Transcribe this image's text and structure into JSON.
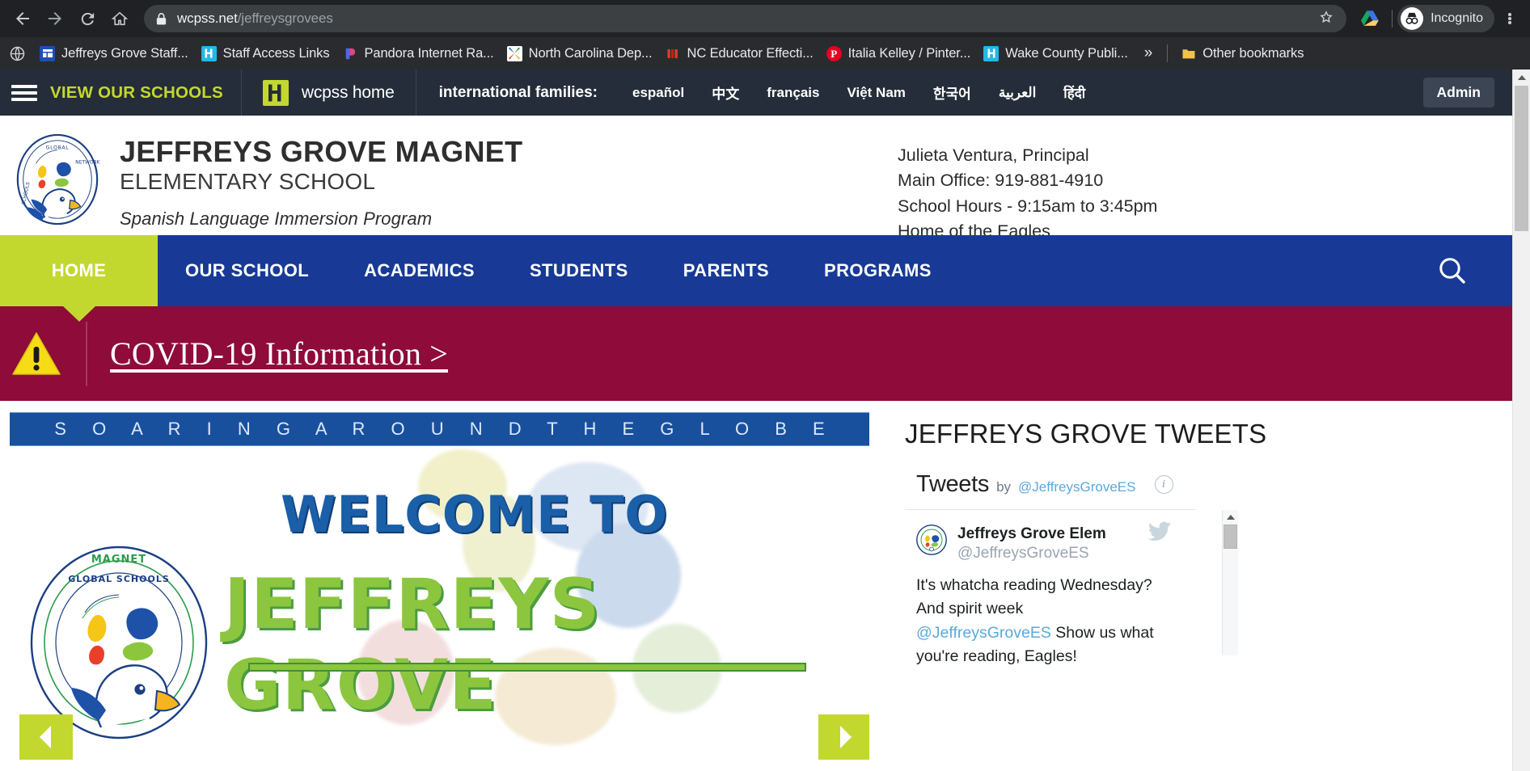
{
  "browser": {
    "url_domain": "wcpss.net",
    "url_path": "/jeffreysgrovees",
    "profile_label": "Incognito",
    "back_icon": "back-arrow-icon",
    "forward_icon": "forward-arrow-icon",
    "reload_icon": "reload-icon",
    "home_icon": "home-icon",
    "lock_icon": "lock-icon",
    "star_icon": "bookmark-star-icon",
    "extension_icon": "google-drive-icon",
    "menu_icon": "kebab-menu-icon",
    "bookmarks": [
      {
        "label": "Jeffreys Grove Staff...",
        "icon": "site-favicon"
      },
      {
        "label": "Staff Access Links",
        "icon": "site-favicon"
      },
      {
        "label": "Pandora Internet Ra...",
        "icon": "pandora-favicon"
      },
      {
        "label": "North Carolina Dep...",
        "icon": "nc-favicon"
      },
      {
        "label": "NC Educator Effecti...",
        "icon": "nc-educator-favicon"
      },
      {
        "label": "Italia Kelley / Pinter...",
        "icon": "pinterest-favicon"
      },
      {
        "label": "Wake County Publi...",
        "icon": "wcpss-favicon"
      }
    ],
    "overflow_label": "»",
    "other_bookmarks_label": "Other bookmarks",
    "globe_icon": "apps-globe-icon"
  },
  "utility_bar": {
    "view_schools_label": "VIEW OUR SCHOOLS",
    "hamburger_icon": "hamburger-menu-icon",
    "wcpss_home_label": "wcpss home",
    "wcpss_logo_icon": "wcpss-logo-icon",
    "international_label": "international families:",
    "languages": [
      {
        "label": "español",
        "bold": true
      },
      {
        "label": "中文",
        "bold": true
      },
      {
        "label": "français",
        "bold": true
      },
      {
        "label": "Việt Nam",
        "bold": true
      },
      {
        "label": "한국어",
        "bold": true
      },
      {
        "label": "العربية",
        "bold": true
      },
      {
        "label": "हिंदी",
        "bold": true
      }
    ],
    "admin_label": "Admin"
  },
  "school_header": {
    "seal_icon": "global-schools-network-eagle-seal",
    "name": "JEFFREYS GROVE MAGNET",
    "subname": "ELEMENTARY SCHOOL",
    "tagline": "Spanish Language Immersion Program",
    "contact": [
      "Julieta Ventura, Principal",
      "Main Office: 919-881-4910",
      "School Hours - 9:15am to 3:45pm",
      "Home of the Eagles"
    ]
  },
  "main_nav": {
    "items": [
      {
        "label": "HOME",
        "active": true
      },
      {
        "label": "OUR SCHOOL",
        "active": false
      },
      {
        "label": "ACADEMICS",
        "active": false
      },
      {
        "label": "STUDENTS",
        "active": false
      },
      {
        "label": "PARENTS",
        "active": false
      },
      {
        "label": "PROGRAMS",
        "active": false
      }
    ],
    "search_icon": "search-icon"
  },
  "alert": {
    "warning_icon": "warning-triangle-icon",
    "link_label": "COVID-19 Information >"
  },
  "hero": {
    "strip_text": "S O A R I N G   A R O U N D   T H E   G L O B E",
    "welcome_text": "WELCOME TO",
    "school_text": "JEFFREYS GROVE",
    "seal_icon": "jeffreys-grove-magnet-elementary-seal",
    "prev_icon": "carousel-prev-arrow-icon",
    "next_icon": "carousel-next-arrow-icon"
  },
  "tweets": {
    "heading": "JEFFREYS GROVE TWEETS",
    "widget_title": "Tweets",
    "widget_by": "by",
    "widget_handle": "@JeffreysGroveES",
    "info_icon": "info-icon",
    "bird_icon": "twitter-bird-icon",
    "avatar_icon": "jeffreys-grove-avatar",
    "tweet": {
      "display_name": "Jeffreys Grove Elem",
      "handle": "@JeffreysGroveES",
      "text_part1": "It's whatcha reading Wednesday? And spirit week ",
      "mention": "@JeffreysGroveES",
      "text_part2": " Show us what you're reading, Eagles!"
    }
  },
  "colors": {
    "wcpss_navy": "#183a96",
    "wcpss_green": "#c3d82e",
    "alert_maroon": "#8e0b3a",
    "utility_dark": "#252d3a",
    "hero_blue": "#19509e"
  }
}
